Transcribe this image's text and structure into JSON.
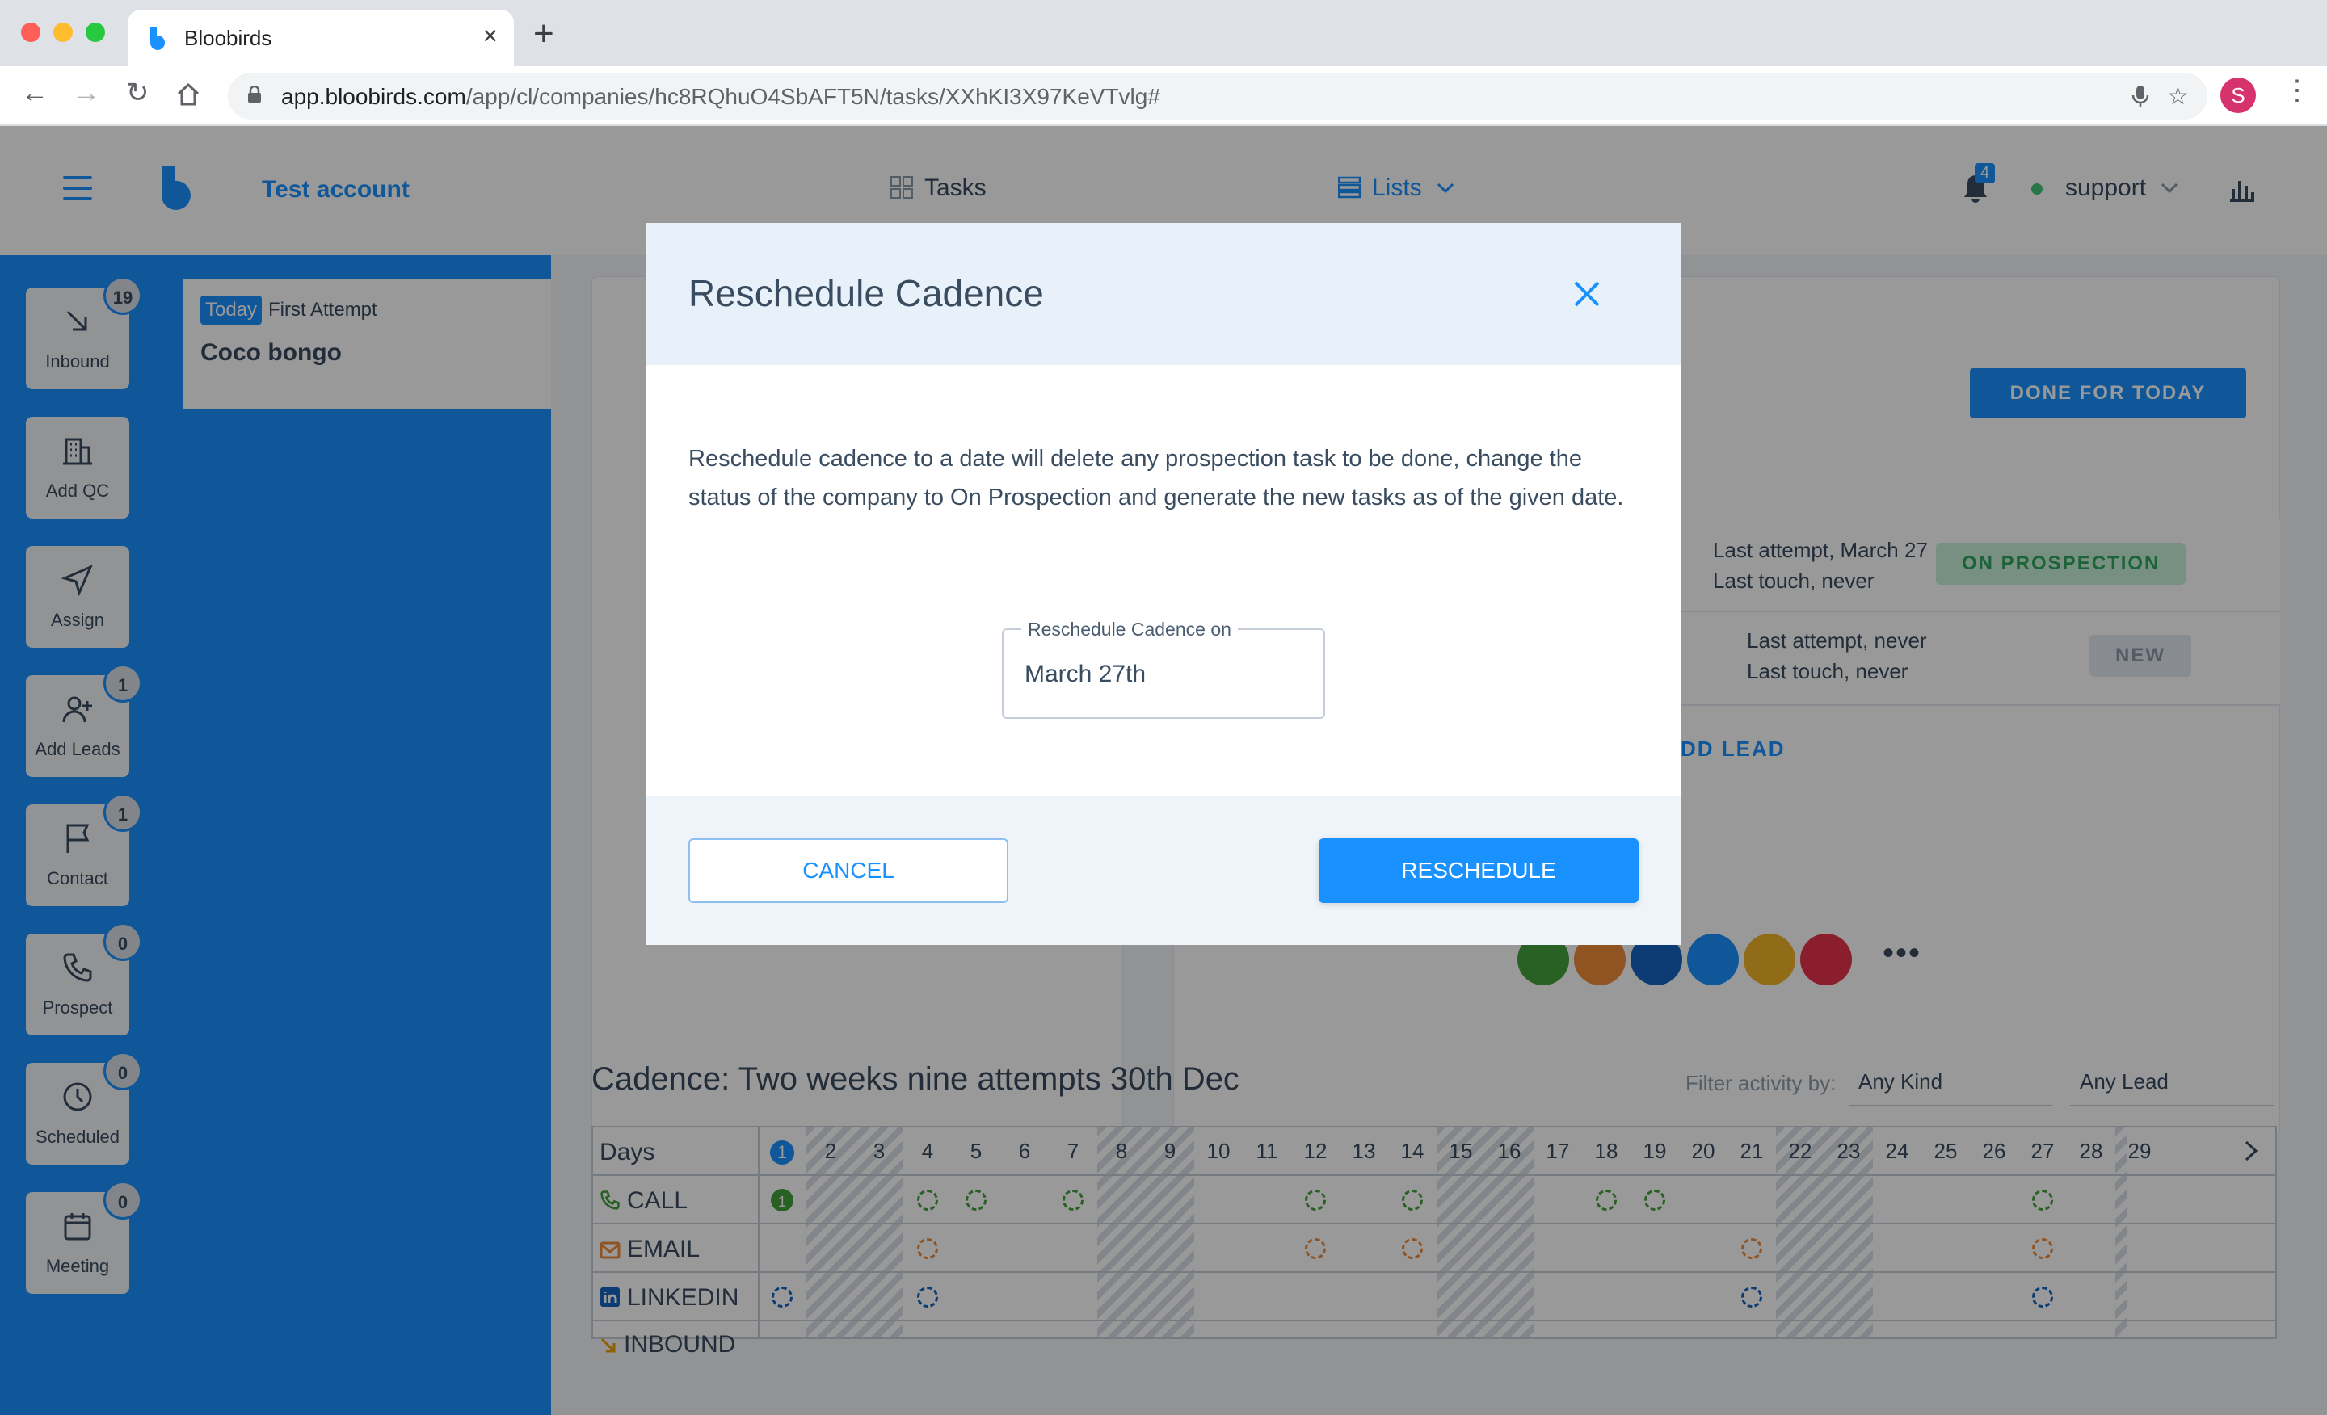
{
  "browser": {
    "tab_title": "Bloobirds",
    "url_host": "app.bloobirds.com",
    "url_path": "/app/cl/companies/hc8RQhuO4SbAFT5N/tasks/XXhKI3X97KeVTvlg#",
    "profile_initial": "S"
  },
  "header": {
    "account_name": "Test account",
    "nav_tasks": "Tasks",
    "nav_lists": "Lists",
    "notifications_count": "4",
    "user_name": "support"
  },
  "sidebar": {
    "items": [
      {
        "label": "Inbound",
        "count": "19"
      },
      {
        "label": "Add QC",
        "count": ""
      },
      {
        "label": "Assign",
        "count": ""
      },
      {
        "label": "Add Leads",
        "count": "1"
      },
      {
        "label": "Contact",
        "count": "1"
      },
      {
        "label": "Prospect",
        "count": "0"
      },
      {
        "label": "Scheduled",
        "count": "0"
      },
      {
        "label": "Meeting",
        "count": "0"
      }
    ]
  },
  "task_card": {
    "today_tag": "Today",
    "attempt_label": "First Attempt",
    "company": "Coco bongo"
  },
  "company_panel": {
    "done_button": "DONE FOR TODAY",
    "leads": [
      {
        "meta1": "Last attempt, March 27",
        "meta2": "Last touch, never",
        "status": "ON PROSPECTION"
      },
      {
        "meta1": "Last attempt, never",
        "meta2": "Last touch, never",
        "status": "NEW"
      }
    ],
    "add_lead": "DD LEAD"
  },
  "cadence": {
    "title": "Cadence: Two weeks nine attempts 30th Dec",
    "filter_label": "Filter activity by:",
    "filter_kind": "Any Kind",
    "filter_lead": "Any Lead",
    "days_header": "Days",
    "days": [
      "1",
      "2",
      "3",
      "4",
      "5",
      "6",
      "7",
      "8",
      "9",
      "10",
      "11",
      "12",
      "13",
      "14",
      "15",
      "16",
      "17",
      "18",
      "19",
      "20",
      "21",
      "22",
      "23",
      "24",
      "25",
      "26",
      "27",
      "28",
      "29"
    ],
    "rows": [
      {
        "label": "CALL"
      },
      {
        "label": "EMAIL"
      },
      {
        "label": "LINKEDIN"
      },
      {
        "label": "INBOUND"
      }
    ],
    "completed_call_count": "1"
  },
  "modal": {
    "title": "Reschedule Cadence",
    "body": "Reschedule cadence to a date will delete any prospection task to be done, change the status of the company to On Prospection and generate the new tasks as of the given date.",
    "field_label": "Reschedule Cadence on",
    "field_value": "March 27th",
    "cancel_label": "CANCEL",
    "confirm_label": "RESCHEDULE"
  },
  "colors": {
    "brand": "#1991ff",
    "call": "#45a03d",
    "email": "#f08b3a",
    "linkedin": "#1565c0",
    "inbound": "#f0a100"
  }
}
